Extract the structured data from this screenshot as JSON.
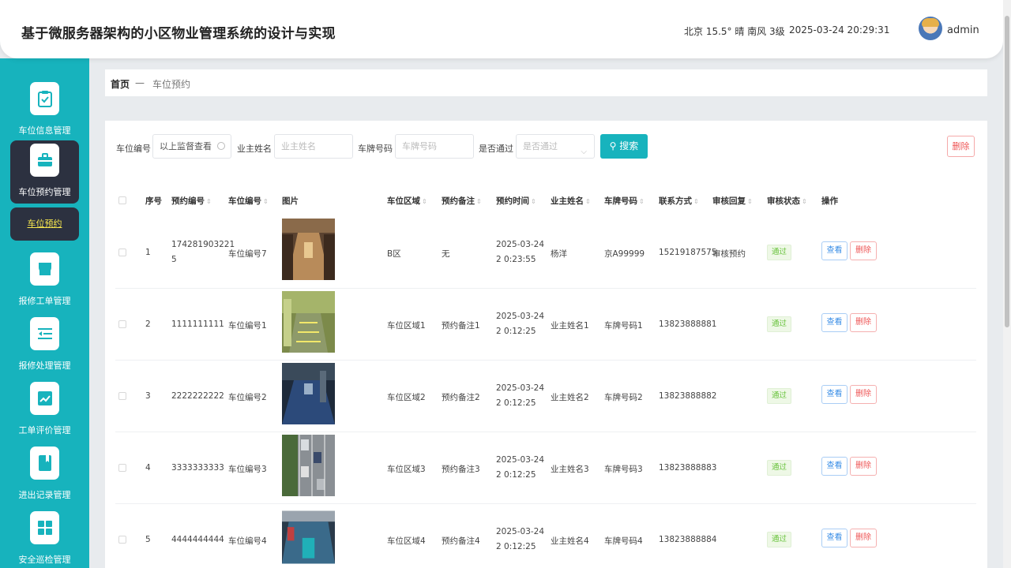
{
  "header": {
    "title": "基于微服务器架构的小区物业管理系统的设计与实现",
    "weather": "北京  15.5°  晴  南风  3级",
    "datetime": "2025-03-24 20:29:31",
    "username": "admin"
  },
  "sidebar": {
    "items": [
      {
        "label": "车位信息管理",
        "icon": "clipboard-check-icon"
      },
      {
        "label": "车位预约管理",
        "icon": "briefcase-icon"
      },
      {
        "label": "报修工单管理",
        "icon": "shop-icon"
      },
      {
        "label": "报修处理管理",
        "icon": "list-indent-icon"
      },
      {
        "label": "工单评价管理",
        "icon": "chart-line-icon"
      },
      {
        "label": "进出记录管理",
        "icon": "bookmark-icon"
      },
      {
        "label": "安全巡检管理",
        "icon": "grid-icon"
      }
    ],
    "sub_active": "车位预约"
  },
  "breadcrumb": {
    "home": "首页",
    "separator": "—",
    "current": "车位预约"
  },
  "filters": {
    "space_no_label": "车位编号",
    "space_no_value": "以上监督查看",
    "owner_label": "业主姓名",
    "owner_placeholder": "业主姓名",
    "plate_label": "车牌号码",
    "plate_placeholder": "车牌号码",
    "passed_label": "是否通过",
    "passed_placeholder": "是否通过",
    "search_label": "搜索",
    "delete_label": "删除"
  },
  "table": {
    "headers": [
      "序号",
      "预约编号",
      "车位编号",
      "图片",
      "车位区域",
      "预约备注",
      "预约时间",
      "业主姓名",
      "车牌号码",
      "联系方式",
      "审核回复",
      "审核状态",
      "操作"
    ],
    "rows": [
      {
        "no": "1",
        "booking_no": "174281903221 5",
        "space_no": "车位编号7",
        "area": "B区",
        "remark": "无",
        "time": "2025-03-24 2 0:23:55",
        "owner": "杨洋",
        "plate": "京A99999",
        "phone": "15219187575",
        "reply": "审核预约",
        "status": "通过"
      },
      {
        "no": "2",
        "booking_no": "1111111111",
        "space_no": "车位编号1",
        "area": "车位区域1",
        "remark": "预约备注1",
        "time": "2025-03-24 2 0:12:25",
        "owner": "业主姓名1",
        "plate": "车牌号码1",
        "phone": "13823888881",
        "reply": "",
        "status": "通过"
      },
      {
        "no": "3",
        "booking_no": "2222222222",
        "space_no": "车位编号2",
        "area": "车位区域2",
        "remark": "预约备注2",
        "time": "2025-03-24 2 0:12:25",
        "owner": "业主姓名2",
        "plate": "车牌号码2",
        "phone": "13823888882",
        "reply": "",
        "status": "通过"
      },
      {
        "no": "4",
        "booking_no": "3333333333",
        "space_no": "车位编号3",
        "area": "车位区域3",
        "remark": "预约备注3",
        "time": "2025-03-24 2 0:12:25",
        "owner": "业主姓名3",
        "plate": "车牌号码3",
        "phone": "13823888883",
        "reply": "",
        "status": "通过"
      },
      {
        "no": "5",
        "booking_no": "4444444444",
        "space_no": "车位编号4",
        "area": "车位区域4",
        "remark": "预约备注4",
        "time": "2025-03-24 2 0:12:25",
        "owner": "业主姓名4",
        "plate": "车牌号码4",
        "phone": "13823888884",
        "reply": "",
        "status": "通过"
      }
    ],
    "view_label": "查看",
    "delete_label": "删除"
  },
  "colors": {
    "sidebar": "#17b3bd",
    "active": "#2c3140",
    "accent": "#17b3bd",
    "danger": "#ee5555",
    "success": "#67c23a"
  }
}
